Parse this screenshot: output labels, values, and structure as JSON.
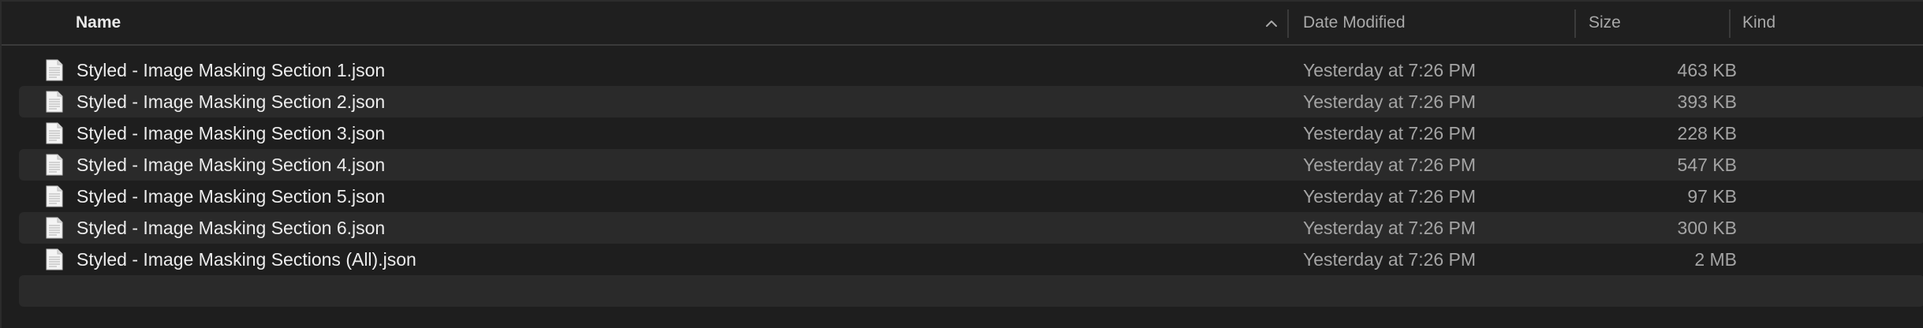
{
  "columns": {
    "name": "Name",
    "date_modified": "Date Modified",
    "size": "Size",
    "kind": "Kind"
  },
  "sort_icon": "chevron-up-icon",
  "file_icon": "document-icon",
  "files": [
    {
      "name": "Styled - Image Masking Section 1.json",
      "date_modified": "Yesterday at 7:26 PM",
      "size": "463 KB",
      "kind": ""
    },
    {
      "name": "Styled - Image Masking Section 2.json",
      "date_modified": "Yesterday at 7:26 PM",
      "size": "393 KB",
      "kind": ""
    },
    {
      "name": "Styled - Image Masking Section 3.json",
      "date_modified": "Yesterday at 7:26 PM",
      "size": "228 KB",
      "kind": ""
    },
    {
      "name": "Styled - Image Masking Section 4.json",
      "date_modified": "Yesterday at 7:26 PM",
      "size": "547 KB",
      "kind": ""
    },
    {
      "name": "Styled - Image Masking Section 5.json",
      "date_modified": "Yesterday at 7:26 PM",
      "size": "97 KB",
      "kind": ""
    },
    {
      "name": "Styled - Image Masking Section 6.json",
      "date_modified": "Yesterday at 7:26 PM",
      "size": "300 KB",
      "kind": ""
    },
    {
      "name": "Styled - Image Masking Sections (All).json",
      "date_modified": "Yesterday at 7:26 PM",
      "size": "2 MB",
      "kind": ""
    }
  ],
  "colors": {
    "background": "#1e1e1e",
    "alternate_row": "#2a2a2a",
    "primary_text": "#ececec",
    "secondary_text": "#a4a4a4"
  }
}
